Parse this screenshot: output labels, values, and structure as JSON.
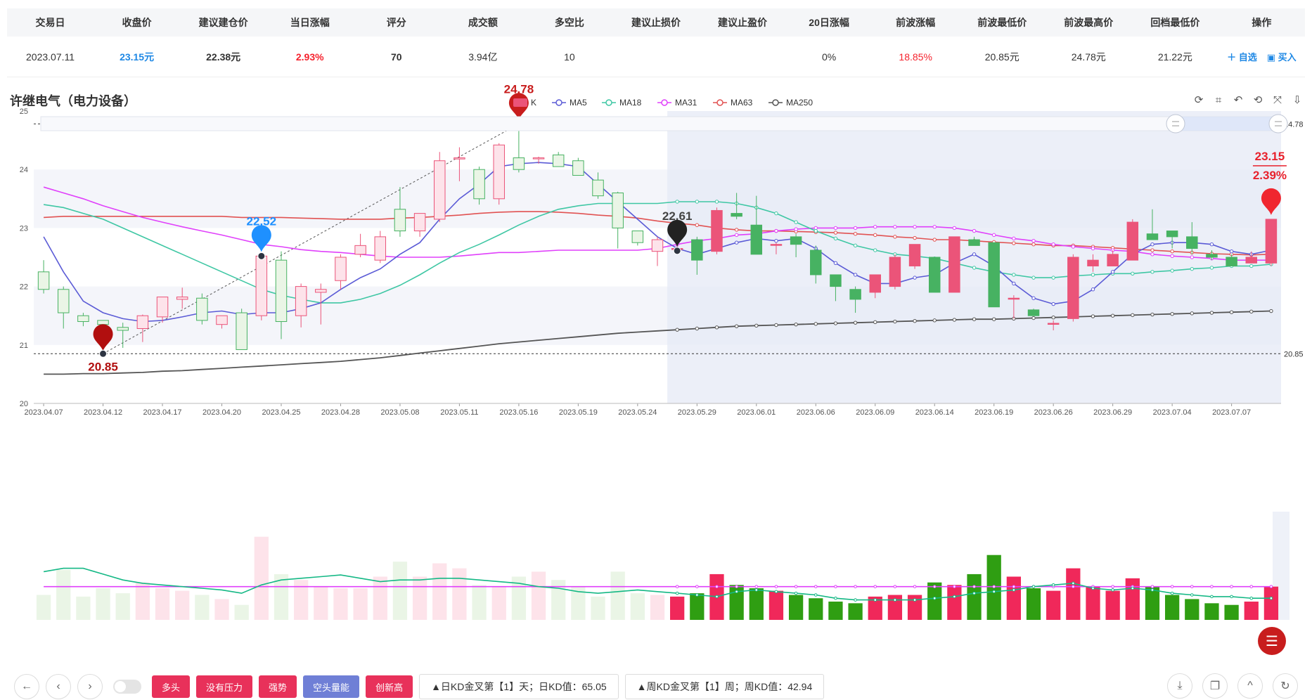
{
  "summary": {
    "headers": [
      "交易日",
      "收盘价",
      "建议建仓价",
      "当日涨幅",
      "评分",
      "成交额",
      "多空比",
      "建议止损价",
      "建议止盈价",
      "20日涨幅",
      "前波涨幅",
      "前波最低价",
      "前波最高价",
      "回档最低价",
      "操作"
    ],
    "trade_date": "2023.07.11",
    "close": "23.15元",
    "entry_price": "22.38元",
    "day_change": "2.93%",
    "score": "70",
    "turnover": "3.94亿",
    "long_short": "10",
    "stop_loss": "",
    "take_profit": "",
    "change_20d": "0%",
    "wave_gain": "18.85%",
    "wave_low": "20.85元",
    "wave_high": "24.78元",
    "pullback_low": "21.22元",
    "action_watch": "＋ 自选",
    "action_buy": "买入"
  },
  "chart_title": "许继电气（电力设备）",
  "colors": {
    "up": "#eb5479",
    "down": "#47b262",
    "ma5": "#5b5bd6",
    "ma18": "#3fc7a4",
    "ma31": "#e040fb",
    "ma63": "#e15252",
    "ma250": "#555555",
    "accent": "#c81d1d",
    "blue": "#1e90ff"
  },
  "chart_data": {
    "type": "candlestick",
    "title": "许继电气（电力设备）",
    "legend": [
      "K",
      "MA5",
      "MA18",
      "MA31",
      "MA63",
      "MA250"
    ],
    "legend_position": "top",
    "ylim": [
      20,
      25
    ],
    "y_ticks": [
      "20",
      "21",
      "22",
      "23",
      "24",
      "25"
    ],
    "x_tick_labels": [
      "2023.04.07",
      "2023.04.12",
      "2023.04.17",
      "2023.04.20",
      "2023.04.25",
      "2023.04.28",
      "2023.05.08",
      "2023.05.11",
      "2023.05.16",
      "2023.05.19",
      "2023.05.24",
      "2023.05.29",
      "2023.06.01",
      "2023.06.06",
      "2023.06.09",
      "2023.06.14",
      "2023.06.19",
      "2023.06.26",
      "2023.06.29",
      "2023.07.04",
      "2023.07.07"
    ],
    "markers": {
      "low": {
        "label": "20.85",
        "value": 20.85,
        "index": 3
      },
      "high": {
        "label": "24.78",
        "value": 24.78,
        "index": 24
      },
      "mid": {
        "label": "22.52",
        "value": 22.52,
        "index": 11
      },
      "pullback": {
        "label": "22.61",
        "value": 22.61,
        "index": 32
      },
      "last_price": "23.15",
      "last_change": "2.39%"
    },
    "right_labels": [
      "24.78",
      "20.85"
    ],
    "ohlc": [
      [
        22.25,
        22.45,
        21.88,
        21.95
      ],
      [
        21.95,
        22.0,
        21.28,
        21.55
      ],
      [
        21.5,
        21.55,
        21.32,
        21.4
      ],
      [
        21.42,
        21.42,
        20.85,
        21.35
      ],
      [
        21.3,
        21.38,
        20.95,
        21.25
      ],
      [
        21.28,
        21.52,
        21.05,
        21.5
      ],
      [
        21.48,
        21.82,
        21.38,
        21.82
      ],
      [
        21.78,
        21.98,
        21.62,
        21.82
      ],
      [
        21.8,
        21.88,
        21.35,
        21.42
      ],
      [
        21.35,
        21.5,
        21.28,
        21.5
      ],
      [
        21.55,
        21.62,
        20.92,
        20.92
      ],
      [
        21.5,
        22.55,
        21.42,
        22.52
      ],
      [
        22.45,
        22.6,
        21.1,
        21.4
      ],
      [
        21.5,
        22.05,
        21.3,
        22.0
      ],
      [
        21.9,
        22.05,
        21.35,
        21.95
      ],
      [
        22.1,
        22.55,
        21.95,
        22.5
      ],
      [
        22.55,
        22.9,
        22.5,
        22.7
      ],
      [
        22.45,
        22.95,
        22.4,
        22.85
      ],
      [
        23.32,
        23.7,
        22.85,
        22.95
      ],
      [
        22.95,
        23.25,
        22.85,
        23.25
      ],
      [
        23.15,
        24.3,
        23.1,
        24.15
      ],
      [
        24.18,
        24.38,
        23.8,
        24.2
      ],
      [
        24.0,
        24.05,
        23.4,
        23.5
      ],
      [
        23.5,
        24.45,
        23.4,
        24.42
      ],
      [
        24.2,
        24.78,
        23.95,
        24.0
      ],
      [
        24.2,
        24.22,
        24.1,
        24.2
      ],
      [
        24.25,
        24.3,
        24.1,
        24.05
      ],
      [
        24.15,
        24.2,
        23.9,
        23.9
      ],
      [
        23.82,
        23.95,
        23.5,
        23.55
      ],
      [
        23.6,
        23.62,
        22.65,
        23.0
      ],
      [
        22.95,
        22.95,
        22.7,
        22.75
      ],
      [
        22.6,
        22.85,
        22.35,
        22.8
      ],
      [
        22.65,
        22.8,
        22.6,
        22.65
      ],
      [
        22.8,
        22.85,
        22.2,
        22.45
      ],
      [
        22.6,
        23.35,
        22.55,
        23.3
      ],
      [
        23.25,
        23.6,
        23.15,
        23.2
      ],
      [
        23.05,
        23.55,
        22.55,
        22.55
      ],
      [
        22.72,
        22.75,
        22.55,
        22.72
      ],
      [
        22.85,
        22.9,
        22.5,
        22.72
      ],
      [
        22.62,
        22.7,
        22.05,
        22.2
      ],
      [
        22.2,
        22.2,
        21.75,
        22.0
      ],
      [
        21.95,
        22.0,
        21.55,
        21.78
      ],
      [
        21.9,
        22.2,
        21.8,
        22.2
      ],
      [
        22.0,
        22.55,
        21.95,
        22.5
      ],
      [
        22.35,
        22.72,
        22.3,
        22.72
      ],
      [
        22.5,
        22.5,
        21.9,
        21.9
      ],
      [
        21.9,
        22.85,
        21.9,
        22.85
      ],
      [
        22.8,
        22.85,
        22.7,
        22.7
      ],
      [
        22.75,
        22.75,
        21.65,
        21.65
      ],
      [
        21.8,
        21.85,
        21.45,
        21.8
      ],
      [
        21.6,
        21.62,
        21.5,
        21.5
      ],
      [
        21.37,
        21.42,
        21.25,
        21.37
      ],
      [
        21.45,
        22.55,
        21.4,
        22.5
      ],
      [
        22.35,
        22.55,
        22.25,
        22.45
      ],
      [
        22.35,
        22.62,
        22.35,
        22.55
      ],
      [
        22.45,
        23.15,
        22.45,
        23.1
      ],
      [
        22.9,
        23.32,
        22.9,
        22.8
      ],
      [
        22.95,
        22.95,
        22.65,
        22.85
      ],
      [
        22.85,
        23.1,
        22.55,
        22.65
      ],
      [
        22.55,
        22.62,
        22.45,
        22.5
      ],
      [
        22.5,
        22.55,
        22.35,
        22.35
      ],
      [
        22.4,
        22.6,
        22.4,
        22.5
      ],
      [
        22.4,
        23.15,
        22.35,
        23.15
      ]
    ],
    "ma5": [
      22.85,
      22.25,
      21.75,
      21.55,
      21.45,
      21.4,
      21.42,
      21.48,
      21.55,
      21.58,
      21.52,
      21.55,
      21.55,
      21.62,
      21.72,
      21.95,
      22.15,
      22.3,
      22.55,
      22.75,
      23.15,
      23.5,
      23.75,
      24.05,
      24.1,
      24.12,
      24.1,
      24.05,
      23.75,
      23.45,
      23.15,
      22.85,
      22.65,
      22.55,
      22.65,
      22.75,
      22.82,
      22.78,
      22.82,
      22.65,
      22.4,
      22.2,
      22.05,
      22.05,
      22.15,
      22.2,
      22.4,
      22.55,
      22.35,
      22.05,
      21.8,
      21.7,
      21.75,
      21.95,
      22.25,
      22.55,
      22.72,
      22.75,
      22.75,
      22.72,
      22.6,
      22.55,
      22.62
    ],
    "ma18": [
      23.4,
      23.35,
      23.25,
      23.15,
      23.0,
      22.85,
      22.7,
      22.55,
      22.4,
      22.25,
      22.1,
      21.95,
      21.85,
      21.78,
      21.72,
      21.72,
      21.78,
      21.88,
      22.02,
      22.2,
      22.4,
      22.58,
      22.72,
      22.88,
      23.05,
      23.2,
      23.32,
      23.38,
      23.42,
      23.42,
      23.42,
      23.42,
      23.45,
      23.45,
      23.45,
      23.42,
      23.35,
      23.25,
      23.1,
      22.95,
      22.82,
      22.7,
      22.62,
      22.55,
      22.52,
      22.48,
      22.4,
      22.32,
      22.25,
      22.2,
      22.15,
      22.15,
      22.18,
      22.2,
      22.22,
      22.22,
      22.25,
      22.27,
      22.3,
      22.32,
      22.35,
      22.35,
      22.38
    ],
    "ma31": [
      23.7,
      23.6,
      23.5,
      23.38,
      23.28,
      23.18,
      23.1,
      23.02,
      22.95,
      22.88,
      22.8,
      22.72,
      22.68,
      22.63,
      22.6,
      22.58,
      22.55,
      22.52,
      22.5,
      22.5,
      22.5,
      22.52,
      22.55,
      22.58,
      22.58,
      22.6,
      22.62,
      22.62,
      22.62,
      22.62,
      22.62,
      22.65,
      22.72,
      22.78,
      22.82,
      22.88,
      22.9,
      22.95,
      22.98,
      23.0,
      23.0,
      23.0,
      23.02,
      23.02,
      23.02,
      23.02,
      23.0,
      22.95,
      22.88,
      22.82,
      22.78,
      22.72,
      22.68,
      22.65,
      22.62,
      22.6,
      22.55,
      22.52,
      22.5,
      22.48,
      22.45,
      22.45,
      22.45
    ],
    "ma63": [
      23.18,
      23.2,
      23.2,
      23.2,
      23.2,
      23.2,
      23.2,
      23.2,
      23.2,
      23.2,
      23.18,
      23.18,
      23.18,
      23.17,
      23.16,
      23.15,
      23.15,
      23.15,
      23.17,
      23.18,
      23.2,
      23.22,
      23.25,
      23.27,
      23.28,
      23.28,
      23.27,
      23.25,
      23.22,
      23.2,
      23.17,
      23.12,
      23.08,
      23.05,
      23.0,
      22.97,
      22.95,
      22.95,
      22.94,
      22.93,
      22.92,
      22.9,
      22.88,
      22.85,
      22.83,
      22.8,
      22.8,
      22.78,
      22.76,
      22.74,
      22.72,
      22.7,
      22.7,
      22.68,
      22.66,
      22.64,
      22.62,
      22.6,
      22.58,
      22.56,
      22.55,
      22.54,
      22.55
    ],
    "ma250": [
      20.5,
      20.5,
      20.51,
      20.51,
      20.52,
      20.53,
      20.55,
      20.56,
      20.58,
      20.6,
      20.62,
      20.64,
      20.66,
      20.68,
      20.7,
      20.72,
      20.75,
      20.78,
      20.82,
      20.86,
      20.9,
      20.94,
      20.98,
      21.02,
      21.05,
      21.08,
      21.11,
      21.14,
      21.17,
      21.2,
      21.22,
      21.24,
      21.26,
      21.28,
      21.3,
      21.32,
      21.33,
      21.34,
      21.35,
      21.36,
      21.37,
      21.38,
      21.39,
      21.4,
      21.41,
      21.42,
      21.43,
      21.44,
      21.44,
      21.45,
      21.46,
      21.47,
      21.48,
      21.49,
      21.5,
      21.51,
      21.52,
      21.53,
      21.54,
      21.55,
      21.56,
      21.57,
      21.58
    ],
    "volume": [
      30,
      60,
      28,
      38,
      32,
      45,
      38,
      35,
      30,
      25,
      18,
      100,
      55,
      48,
      40,
      38,
      38,
      52,
      70,
      52,
      68,
      62,
      42,
      40,
      52,
      58,
      48,
      40,
      28,
      58,
      32,
      30,
      28,
      32,
      55,
      42,
      38,
      35,
      30,
      26,
      22,
      20,
      28,
      30,
      30,
      45,
      42,
      55,
      78,
      52,
      38,
      35,
      62,
      40,
      35,
      50,
      40,
      30,
      25,
      20,
      18,
      22,
      40
    ],
    "vol_ma_a": [
      58,
      62,
      62,
      55,
      48,
      44,
      42,
      40,
      38,
      36,
      32,
      42,
      48,
      50,
      52,
      54,
      50,
      46,
      48,
      48,
      50,
      50,
      48,
      46,
      44,
      40,
      38,
      34,
      32,
      34,
      36,
      34,
      32,
      30,
      28,
      34,
      36,
      34,
      32,
      30,
      26,
      24,
      24,
      24,
      24,
      26,
      28,
      32,
      34,
      36,
      40,
      42,
      44,
      38,
      36,
      38,
      36,
      32,
      30,
      28,
      28,
      26,
      26
    ],
    "vol_ma_b": [
      40,
      40,
      40,
      40,
      40,
      40,
      40,
      40,
      40,
      40,
      40,
      40,
      40,
      40,
      40,
      40,
      40,
      40,
      40,
      40,
      40,
      40,
      40,
      40,
      40,
      40,
      40,
      40,
      40,
      40,
      40,
      40,
      40,
      40,
      40,
      40,
      40,
      40,
      40,
      40,
      40,
      40,
      40,
      40,
      40,
      40,
      40,
      40,
      40,
      40,
      40,
      40,
      40,
      40,
      40,
      40,
      40,
      40,
      40,
      40,
      40,
      40,
      40
    ],
    "vol_max": 120,
    "zoom_start_index": 32
  },
  "toolbar": {
    "kd_daily": "▲日KD金叉第【1】天；日KD值：65.05",
    "kd_weekly": "▲周KD金叉第【1】周；周KD值：42.94",
    "tags": [
      "多头",
      "没有压力",
      "强势",
      "空头量能",
      "创新高"
    ]
  }
}
